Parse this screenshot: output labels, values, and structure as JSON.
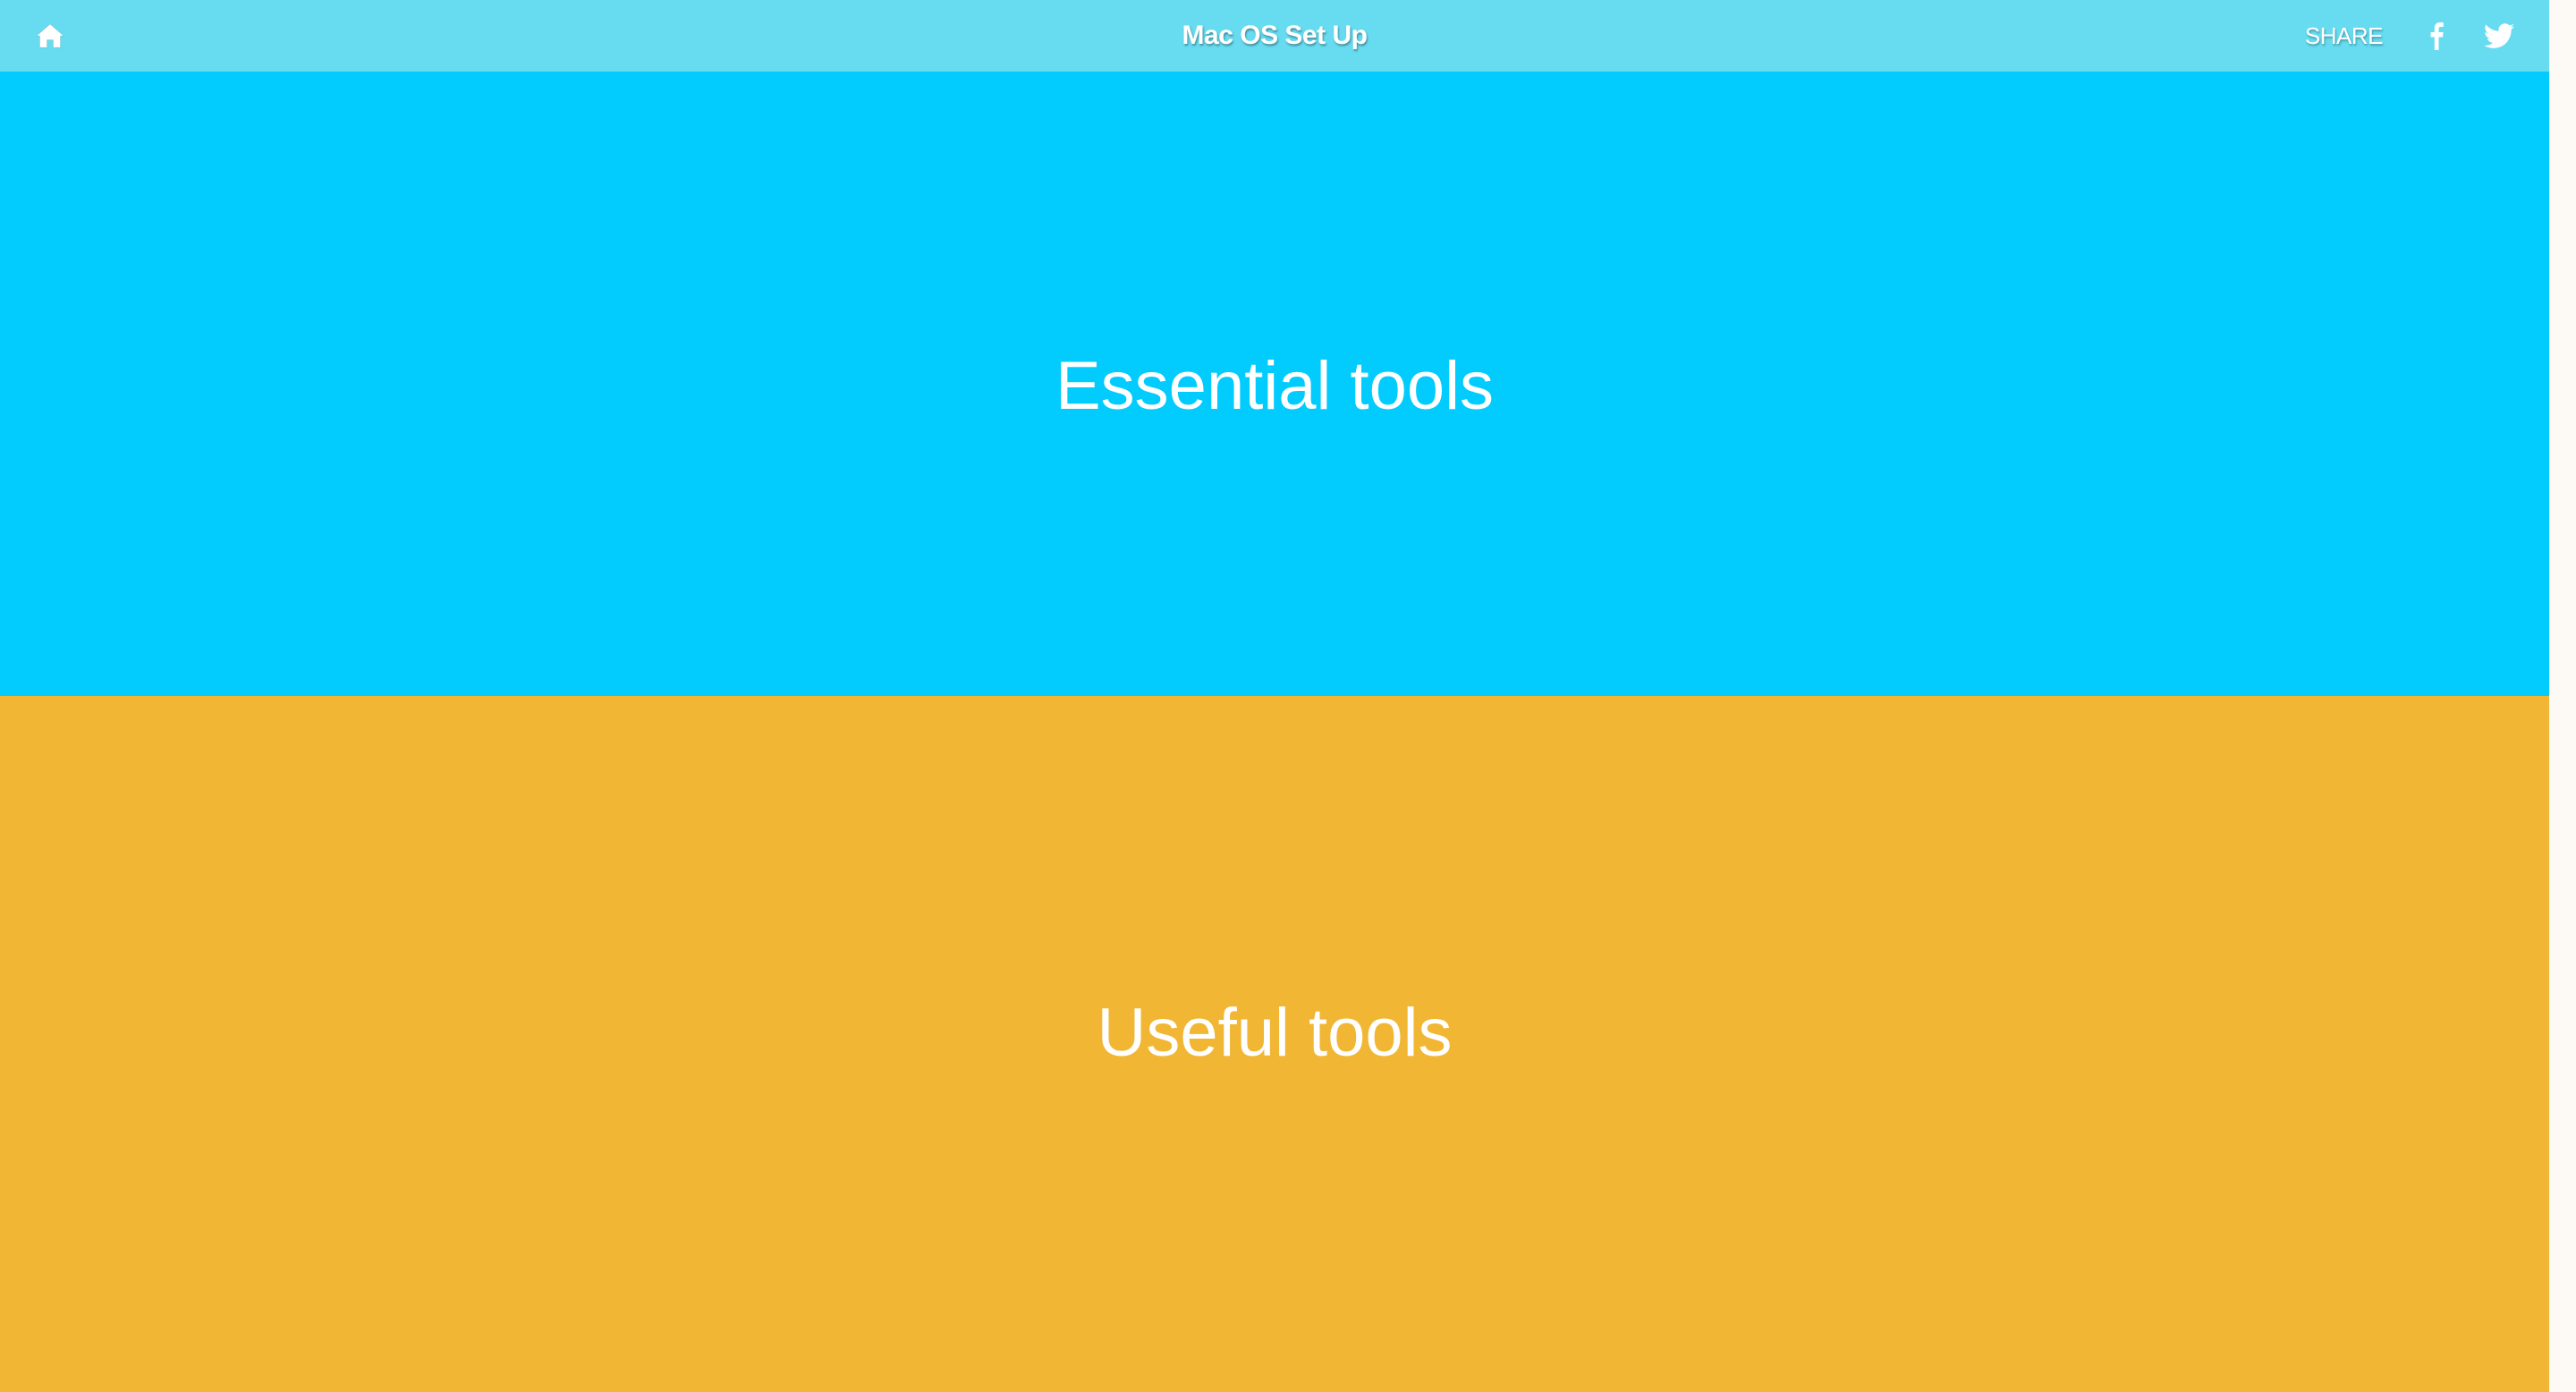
{
  "header": {
    "title": "Mac OS Set Up",
    "share_label": "SHARE",
    "icons": {
      "home": "home-icon",
      "facebook": "facebook-icon",
      "twitter": "twitter-icon"
    },
    "background": "#67dbf0"
  },
  "sections": [
    {
      "title": "Essential tools",
      "color": "#02cbfe"
    },
    {
      "title": "Useful tools",
      "color": "#f1b734"
    }
  ]
}
